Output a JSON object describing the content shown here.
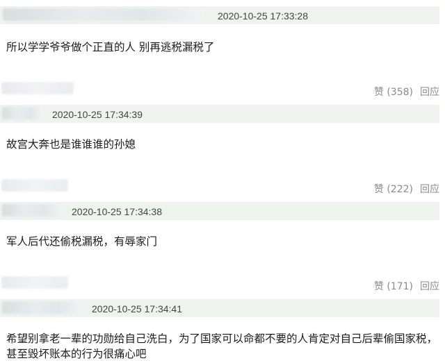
{
  "comments": [
    {
      "timestamp": "2020-10-25 17:33:28",
      "text": "所以学学爷爷做个正直的人 别再逃税漏税了",
      "like_label": "赞 (358)",
      "reply_label": "回应"
    },
    {
      "timestamp": "2020-10-25 17:34:39",
      "text": "故宫大奔也是谁谁谁的孙媳",
      "like_label": "赞 (222)",
      "reply_label": "回应"
    },
    {
      "timestamp": "2020-10-25 17:34:38",
      "text": "军人后代还偷税漏税，有辱家门",
      "like_label": "赞 (171)",
      "reply_label": "回应"
    },
    {
      "timestamp": "2020-10-25 17:34:41",
      "text": "希望别拿老一辈的功勋给自己洗白，为了国家可以命都不要的人肯定对自己后辈偷国家税，甚至毁坏账本的行为很痛心吧"
    }
  ]
}
